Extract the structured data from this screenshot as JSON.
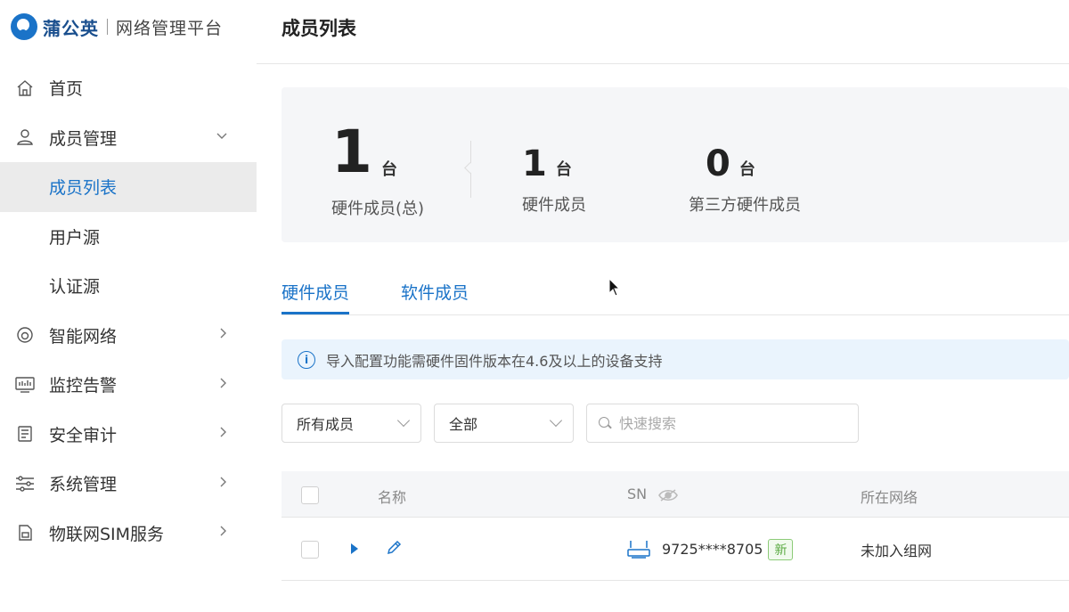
{
  "brand": {
    "name": "蒲公英",
    "subtitle": "网络管理平台"
  },
  "sidebar": {
    "items": [
      {
        "label": "首页",
        "icon": "home-icon"
      },
      {
        "label": "成员管理",
        "icon": "user-icon",
        "expanded": true
      },
      {
        "label": "成员列表",
        "sub": true,
        "active": true
      },
      {
        "label": "用户源",
        "sub": true
      },
      {
        "label": "认证源",
        "sub": true
      },
      {
        "label": "智能网络",
        "icon": "network-icon"
      },
      {
        "label": "监控告警",
        "icon": "monitor-icon"
      },
      {
        "label": "安全审计",
        "icon": "audit-icon"
      },
      {
        "label": "系统管理",
        "icon": "settings-icon"
      },
      {
        "label": "物联网SIM服务",
        "icon": "sim-icon"
      }
    ]
  },
  "page": {
    "title": "成员列表"
  },
  "stats": [
    {
      "value": "1",
      "unit": "台",
      "label": "硬件成员(总)"
    },
    {
      "value": "1",
      "unit": "台",
      "label": "硬件成员"
    },
    {
      "value": "0",
      "unit": "台",
      "label": "第三方硬件成员"
    }
  ],
  "tabs": [
    {
      "label": "硬件成员",
      "active": true
    },
    {
      "label": "软件成员",
      "active": false
    }
  ],
  "notice": {
    "text": "导入配置功能需硬件固件版本在4.6及以上的设备支持"
  },
  "filters": {
    "member_scope": "所有成员",
    "status": "全部",
    "search_placeholder": "快速搜索"
  },
  "table": {
    "columns": [
      "名称",
      "SN",
      "所在网络"
    ],
    "rows": [
      {
        "name": "",
        "sn": "9725****8705",
        "sn_badge": "新",
        "network": "未加入组网"
      }
    ]
  },
  "colors": {
    "accent": "#1a73c8",
    "badge_green": "#5aaa42"
  }
}
